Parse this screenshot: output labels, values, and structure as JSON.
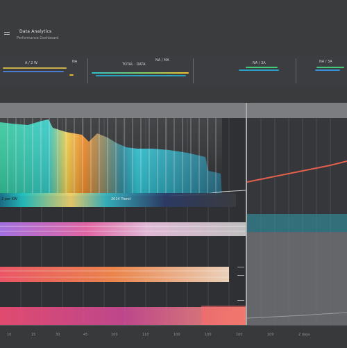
{
  "header": {
    "title": "Data Analytics",
    "subtitle": "Performance Dashboard"
  },
  "metrics": [
    {
      "label": "A / 2 W",
      "accent": "#f1c232"
    },
    {
      "label": "NA",
      "accent": "#e06666"
    },
    {
      "label": "TOTAL · DATA",
      "accent": "#35c0c8"
    },
    {
      "label": "NA / MA",
      "accent": "#d08a3a"
    },
    {
      "label": "NA / 3A",
      "accent": "#44c979"
    },
    {
      "label": "NA / 3A",
      "accent": "#44c979"
    }
  ],
  "legend": {
    "left": "2 per KW",
    "mid": "2014 Trend"
  },
  "footer": {
    "ticks": [
      "10",
      "15",
      "30",
      "45",
      "100",
      "110",
      "100",
      "100",
      "100",
      "100",
      "2 days"
    ]
  },
  "colors": {
    "teal": "#22c3c2",
    "green": "#33c27a",
    "yellow": "#f0c33a",
    "orange": "#e88b2c",
    "red": "#e05a4a",
    "pink": "#e56aa8",
    "purple": "#9b6be0",
    "blue": "#3c7fd6"
  }
}
